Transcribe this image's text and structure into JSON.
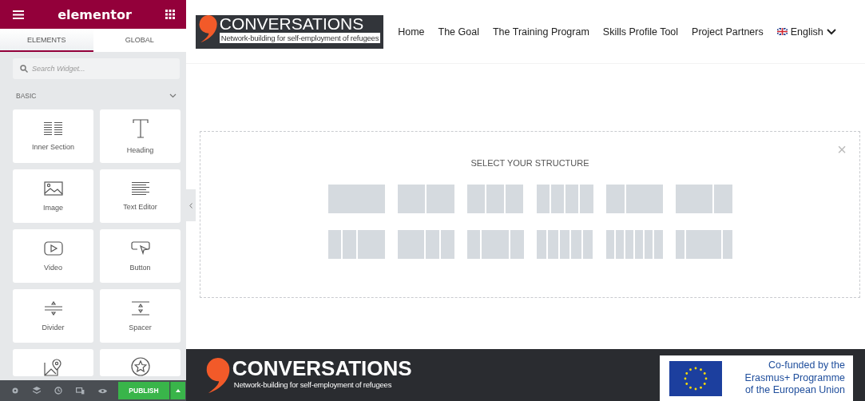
{
  "editor": {
    "brand": "elementor",
    "tabs": [
      {
        "label": "ELEMENTS",
        "selected": true
      },
      {
        "label": "GLOBAL",
        "selected": false
      }
    ],
    "search": {
      "placeholder": "Search Widget..."
    },
    "category": {
      "label": "BASIC",
      "expanded": true
    },
    "widgets": [
      {
        "kind": "full",
        "label": "Inner Section"
      },
      {
        "kind": "full",
        "label": "Heading"
      },
      {
        "kind": "full",
        "label": "Image"
      },
      {
        "kind": "full",
        "label": "Text Editor"
      },
      {
        "kind": "full",
        "label": "Video"
      },
      {
        "kind": "full",
        "label": "Button"
      },
      {
        "kind": "full",
        "label": "Divider"
      },
      {
        "kind": "full",
        "label": "Spacer"
      },
      {
        "kind": "partial"
      },
      {
        "kind": "partial"
      }
    ],
    "publish_button": "PUBLISH"
  },
  "site": {
    "logo": {
      "name": "CONVERSATIONS",
      "tagline": "Network-building for self-employment of refugees"
    },
    "nav": [
      {
        "label": "Home"
      },
      {
        "label": "The Goal"
      },
      {
        "label": "The Training Program"
      },
      {
        "label": "Skills Profile Tool"
      },
      {
        "label": "Project Partners"
      },
      {
        "label": "English",
        "kind": "language"
      }
    ],
    "structure_panel": {
      "title": "SELECT YOUR STRUCTURE",
      "close": "×"
    },
    "footer": {
      "logo": {
        "name": "CONVERSATIONS",
        "tagline": "Network-building for self-employment of refugees"
      },
      "funding": [
        "Co-funded by the",
        "Erasmus+ Programme",
        "of the European Union"
      ]
    }
  }
}
